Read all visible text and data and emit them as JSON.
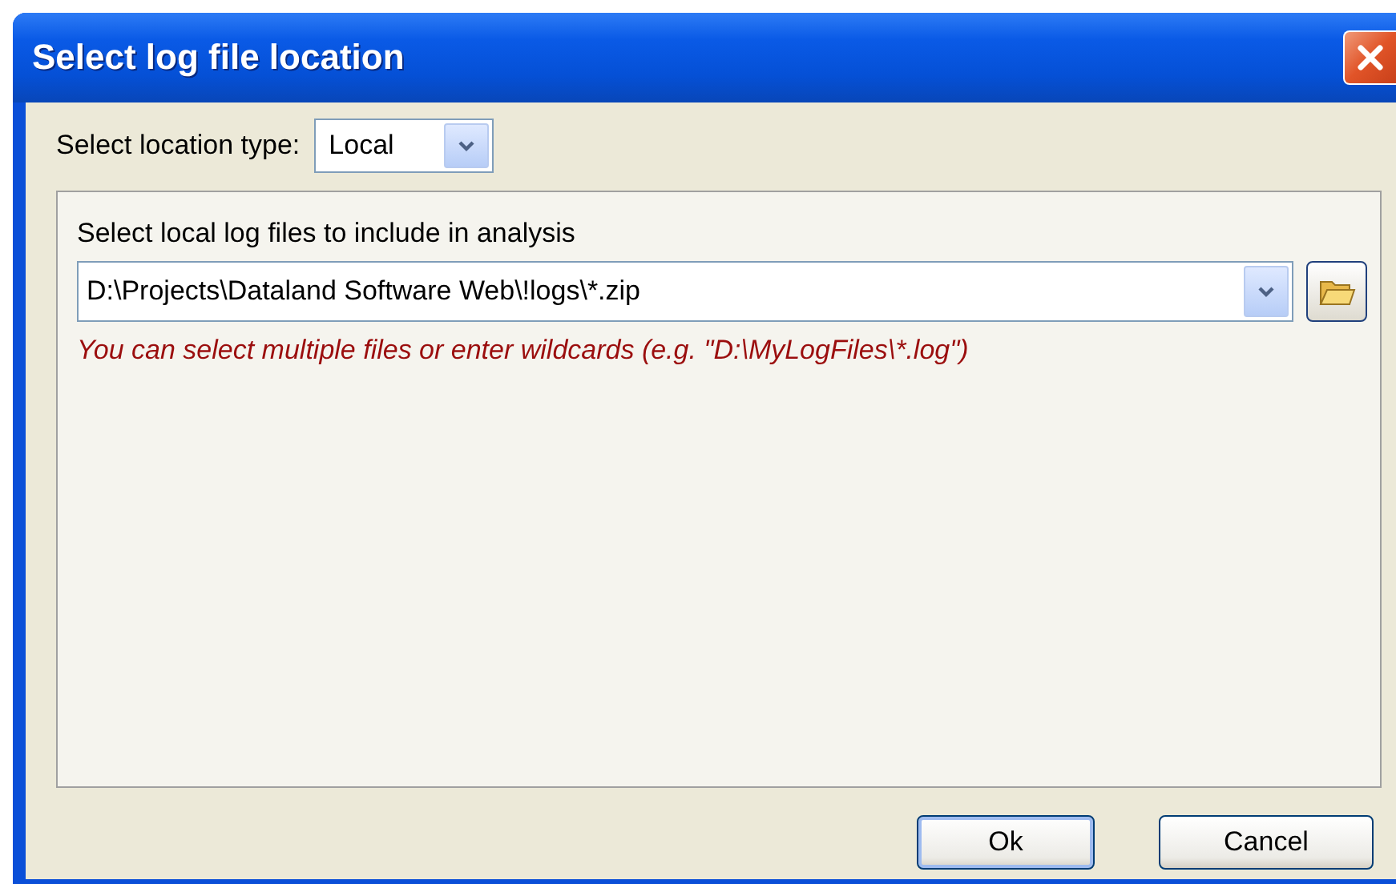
{
  "window": {
    "title": "Select log file location"
  },
  "location_type": {
    "label": "Select location type:",
    "value": "Local"
  },
  "panel": {
    "label": "Select local log files to include in analysis",
    "path": "D:\\Projects\\Dataland Software Web\\!logs\\*.zip",
    "hint": "You can select multiple files or enter wildcards (e.g. \"D:\\MyLogFiles\\*.log\")"
  },
  "buttons": [
    {
      "label": "Ok",
      "default": true
    },
    {
      "label": "Cancel",
      "default": false
    }
  ]
}
